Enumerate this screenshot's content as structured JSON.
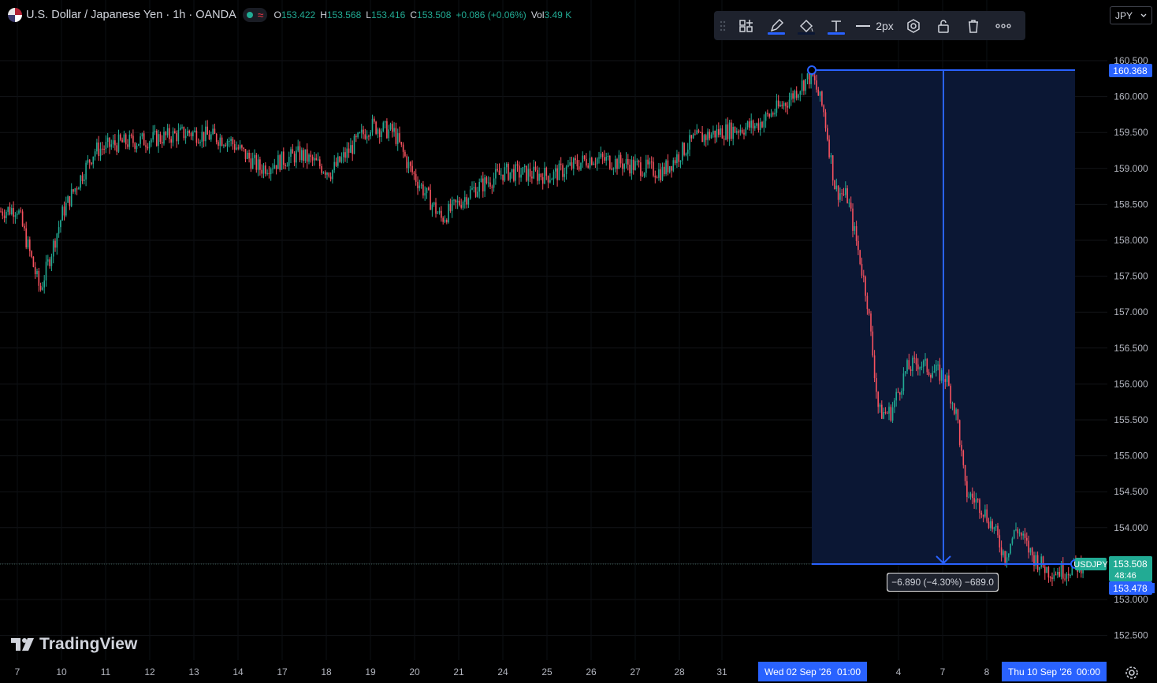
{
  "legend": {
    "symbol_title": "U.S. Dollar / Japanese Yen · 1h · OANDA",
    "ohlc": {
      "open_label": "O",
      "open": "153.422",
      "high_label": "H",
      "high": "153.568",
      "low_label": "L",
      "low": "153.416",
      "close_label": "C",
      "close": "153.508",
      "change": "+0.086 (+0.06%)",
      "vol_label": "Vol",
      "vol": "3.49 K"
    }
  },
  "toolbar": {
    "line_width_label": "2px"
  },
  "currency_selector": {
    "value": "JPY"
  },
  "brand": {
    "name": "TradingView"
  },
  "colors": {
    "up": "#22ab94",
    "down": "#f7525f",
    "accent": "#2962ff",
    "current_price_bg": "#22ab94",
    "range_fill": "#0b1734"
  },
  "price_axis": {
    "ticks": [
      "160.500",
      "160.000",
      "159.500",
      "159.000",
      "158.500",
      "158.000",
      "157.500",
      "157.000",
      "156.500",
      "156.000",
      "155.500",
      "155.000",
      "154.500",
      "154.000",
      "153.500",
      "153.000",
      "152.500"
    ]
  },
  "time_axis": {
    "labels": [
      "7",
      "10",
      "11",
      "12",
      "13",
      "14",
      "17",
      "18",
      "19",
      "20",
      "21",
      "24",
      "25",
      "26",
      "27",
      "28",
      "31",
      "4",
      "7",
      "8"
    ],
    "highlight_start": "Wed 02 Sep '26",
    "highlight_start_time": "01:00",
    "highlight_end": "Thu 10 Sep '26",
    "highlight_end_time": "00:00"
  },
  "price_labels": {
    "range_top": "160.368",
    "current_symbol": "USDJPY",
    "current_price": "153.508",
    "countdown": "48:46",
    "range_bottom": "153.478"
  },
  "measure": {
    "label": "−6.890 (−4.30%) −689.0"
  },
  "chart_data": {
    "type": "candlestick",
    "symbol": "USDJPY",
    "interval": "1h",
    "ylim": [
      152.25,
      160.75
    ],
    "grid": true,
    "current_price": 153.508,
    "date_range_measure": {
      "from_date": "Wed 02 Sep '26 01:00",
      "to_date": "Thu 10 Sep '26 00:00",
      "from_price": 160.368,
      "to_price": 153.478,
      "change": -6.89,
      "change_percent": -4.3,
      "pips": -689.0
    },
    "approx_closes": [
      {
        "date": "7",
        "value": 158.45
      },
      {
        "date": "10",
        "value": 157.9
      },
      {
        "date": "11",
        "value": 159.25
      },
      {
        "date": "12",
        "value": 159.3
      },
      {
        "date": "13",
        "value": 159.45
      },
      {
        "date": "14",
        "value": 159.4
      },
      {
        "date": "17",
        "value": 159.25
      },
      {
        "date": "18",
        "value": 159.7
      },
      {
        "date": "19",
        "value": 159.2
      },
      {
        "date": "20",
        "value": 158.2
      },
      {
        "date": "21",
        "value": 158.9
      },
      {
        "date": "24",
        "value": 158.9
      },
      {
        "date": "25",
        "value": 159.25
      },
      {
        "date": "26",
        "value": 159.05
      },
      {
        "date": "27",
        "value": 159.35
      },
      {
        "date": "28",
        "value": 159.5
      },
      {
        "date": "31",
        "value": 159.7
      },
      {
        "date": "Wed 02 Sep '26",
        "value": 160.3
      },
      {
        "date": "4",
        "value": 156.2
      },
      {
        "date": "7",
        "value": 156.1
      },
      {
        "date": "8",
        "value": 154.3
      },
      {
        "date": "Thu 10 Sep '26",
        "value": 153.5
      }
    ]
  }
}
